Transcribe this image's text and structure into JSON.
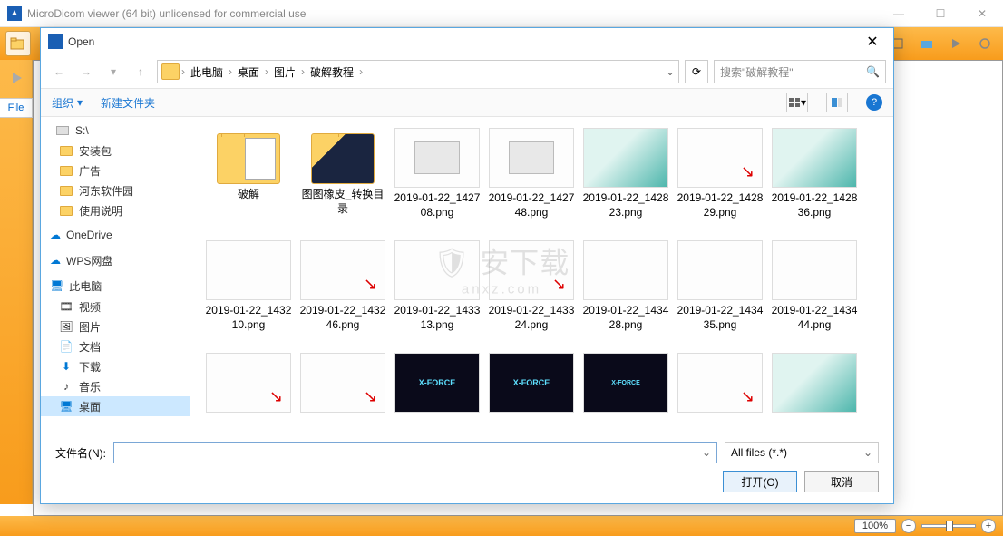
{
  "app": {
    "title": "MicroDicom viewer (64 bit) unlicensed for commercial use",
    "file_tab": "File",
    "zoom": "100%"
  },
  "dialog": {
    "title": "Open",
    "breadcrumb": [
      "此电脑",
      "桌面",
      "图片",
      "破解教程"
    ],
    "search_placeholder": "搜索\"破解教程\"",
    "organize": "组织",
    "new_folder": "新建文件夹",
    "filename_label": "文件名(N):",
    "filename_value": "",
    "filter": "All files (*.*)",
    "open_btn": "打开(O)",
    "cancel_btn": "取消"
  },
  "sidebar": {
    "drive": "S:\\",
    "folders": [
      "安装包",
      "广告",
      "河东软件园",
      "使用说明"
    ],
    "onedrive": "OneDrive",
    "wps": "WPS网盘",
    "thispc": "此电脑",
    "pc_items": [
      "视频",
      "图片",
      "文档",
      "下载",
      "音乐",
      "桌面"
    ]
  },
  "files": [
    {
      "name": "破解",
      "type": "folder"
    },
    {
      "name": "图图橡皮_转换目录",
      "type": "folder-img"
    },
    {
      "name": "2019-01-22_142708.png",
      "type": "img",
      "style": "box"
    },
    {
      "name": "2019-01-22_142748.png",
      "type": "img",
      "style": "box"
    },
    {
      "name": "2019-01-22_142823.png",
      "type": "img",
      "style": "teal"
    },
    {
      "name": "2019-01-22_142829.png",
      "type": "img",
      "style": "white-red"
    },
    {
      "name": "2019-01-22_142836.png",
      "type": "img",
      "style": "teal"
    },
    {
      "name": "2019-01-22_143210.png",
      "type": "img",
      "style": "white"
    },
    {
      "name": "2019-01-22_143246.png",
      "type": "img",
      "style": "white-red"
    },
    {
      "name": "2019-01-22_143313.png",
      "type": "img",
      "style": "white"
    },
    {
      "name": "2019-01-22_143324.png",
      "type": "img",
      "style": "white-red"
    },
    {
      "name": "2019-01-22_143428.png",
      "type": "img",
      "style": "white"
    },
    {
      "name": "2019-01-22_143435.png",
      "type": "img",
      "style": "white"
    },
    {
      "name": "2019-01-22_143444.png",
      "type": "img",
      "style": "white"
    },
    {
      "name": "",
      "type": "img",
      "style": "white-red"
    },
    {
      "name": "",
      "type": "img",
      "style": "white-red"
    },
    {
      "name": "",
      "type": "img",
      "style": "xforce"
    },
    {
      "name": "",
      "type": "img",
      "style": "xforce"
    },
    {
      "name": "",
      "type": "img",
      "style": "xforce2"
    },
    {
      "name": "",
      "type": "img",
      "style": "white-red"
    },
    {
      "name": "",
      "type": "img",
      "style": "teal"
    }
  ],
  "watermark": {
    "main": "安下载",
    "sub": "anxz.com"
  }
}
